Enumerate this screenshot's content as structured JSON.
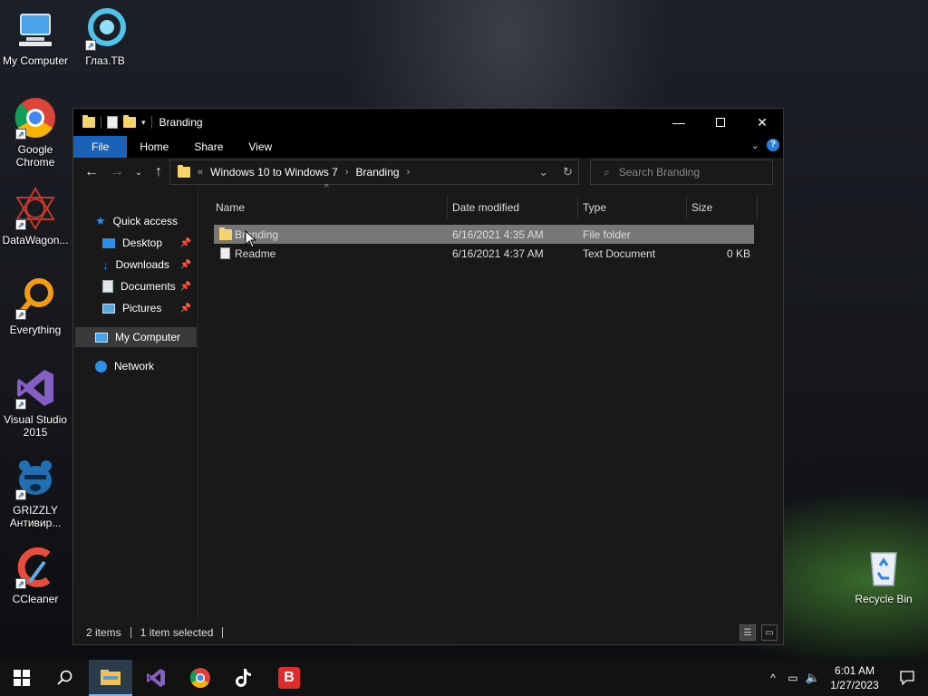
{
  "desktop_icons": [
    {
      "label": "My Computer",
      "icon": "computer-icon"
    },
    {
      "label": "Глаз.ТВ",
      "icon": "eye-tv-icon"
    },
    {
      "label": "Google Chrome",
      "icon": "chrome-icon"
    },
    {
      "label": "DataWagon...",
      "icon": "datawagon-icon"
    },
    {
      "label": "Everything",
      "icon": "everything-search-icon"
    },
    {
      "label": "Visual Studio 2015",
      "icon": "visual-studio-icon"
    },
    {
      "label": "GRIZZLY Антивир...",
      "icon": "grizzly-antivirus-icon"
    },
    {
      "label": "CCleaner",
      "icon": "ccleaner-icon"
    },
    {
      "label": "Recycle Bin",
      "icon": "recycle-bin-icon"
    }
  ],
  "window": {
    "title": "Branding",
    "ribbon_tabs": [
      "File",
      "Home",
      "Share",
      "View"
    ],
    "address": {
      "overflow": "«",
      "crumbs": [
        "Windows 10 to Windows 7",
        "Branding"
      ]
    },
    "search_placeholder": "Search Branding",
    "sidebar": {
      "quick_access": "Quick access",
      "items": [
        "Desktop",
        "Downloads",
        "Documents",
        "Pictures"
      ],
      "my_computer": "My Computer",
      "network": "Network"
    },
    "columns": [
      "Name",
      "Date modified",
      "Type",
      "Size"
    ],
    "files": [
      {
        "name": "Branding",
        "date": "6/16/2021 4:35 AM",
        "type": "File folder",
        "size": "",
        "icon": "folder-icon",
        "selected": true
      },
      {
        "name": "Readme",
        "date": "6/16/2021 4:37 AM",
        "type": "Text Document",
        "size": "0 KB",
        "icon": "text-file-icon",
        "selected": false
      }
    ],
    "status": {
      "items": "2 items",
      "selected": "1 item selected"
    }
  },
  "taskbar": {
    "apps": [
      "file-explorer-icon",
      "visual-studio-icon",
      "chrome-icon",
      "tiktok-icon",
      "bandicam-icon"
    ],
    "time": "6:01 AM",
    "date": "1/27/2023"
  }
}
